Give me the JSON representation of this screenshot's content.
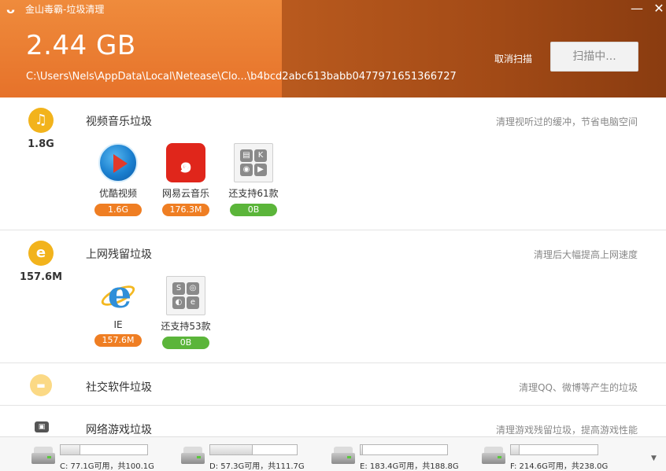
{
  "window": {
    "title": "金山毒霸-垃圾清理",
    "minimize": "—",
    "close": "✕"
  },
  "scan": {
    "total_size": "2.44 GB",
    "current_path": "C:\\Users\\Nels\\AppData\\Local\\Netease\\Clo...\\b4bcd2abc613babb0477971651366727",
    "cancel_label": "取消扫描",
    "scan_button_label": "扫描中..."
  },
  "sections": [
    {
      "title": "视频音乐垃圾",
      "total": "1.8G",
      "desc": "清理视听过的缓冲，节省电脑空间",
      "icon": "music-icon",
      "apps": [
        {
          "name": "优酷视频",
          "size": "1.6G",
          "badge": "orange",
          "logo": "youku-icon"
        },
        {
          "name": "网易云音乐",
          "size": "176.3M",
          "badge": "orange",
          "logo": "netease-music-icon"
        },
        {
          "name": "还支持61款",
          "size": "0B",
          "badge": "green",
          "logo": "more-apps-icon"
        }
      ]
    },
    {
      "title": "上网残留垃圾",
      "total": "157.6M",
      "desc": "清理后大幅提高上网速度",
      "icon": "browser-icon",
      "apps": [
        {
          "name": "IE",
          "size": "157.6M",
          "badge": "orange",
          "logo": "ie-icon"
        },
        {
          "name": "还支持53款",
          "size": "0B",
          "badge": "green",
          "logo": "more-apps-icon"
        }
      ]
    },
    {
      "title": "社交软件垃圾",
      "desc": "清理QQ、微博等产生的垃圾",
      "icon": "chat-icon"
    },
    {
      "title": "网络游戏垃圾",
      "desc": "清理游戏残留垃圾，提高游戏性能",
      "icon": "gamepad-icon"
    }
  ],
  "drives": [
    {
      "label": "C: 77.1G可用，共100.1G",
      "used_fraction": 0.23
    },
    {
      "label": "D: 57.3G可用，共111.7G",
      "used_fraction": 0.49
    },
    {
      "label": "E: 183.4G可用，共188.8G",
      "used_fraction": 0.03
    },
    {
      "label": "F: 214.6G可用，共238.0G",
      "used_fraction": 0.1
    }
  ],
  "colors": {
    "header_orange": "#e8742a",
    "header_dark": "#a84d17",
    "badge_orange": "#ef7e23",
    "badge_green": "#5bb53a",
    "section_icon": "#f2b31c"
  },
  "more_tiles": {
    "video": [
      "▤",
      "K",
      "◉",
      "▶"
    ],
    "web": [
      "S",
      "◎",
      "◐",
      "e"
    ]
  },
  "section_glyphs": {
    "music": "♫",
    "browser": "e",
    "chat": "▬",
    "game": "▣",
    "netease": "๑",
    "ie": "e"
  },
  "scroll_indicator": "▼"
}
